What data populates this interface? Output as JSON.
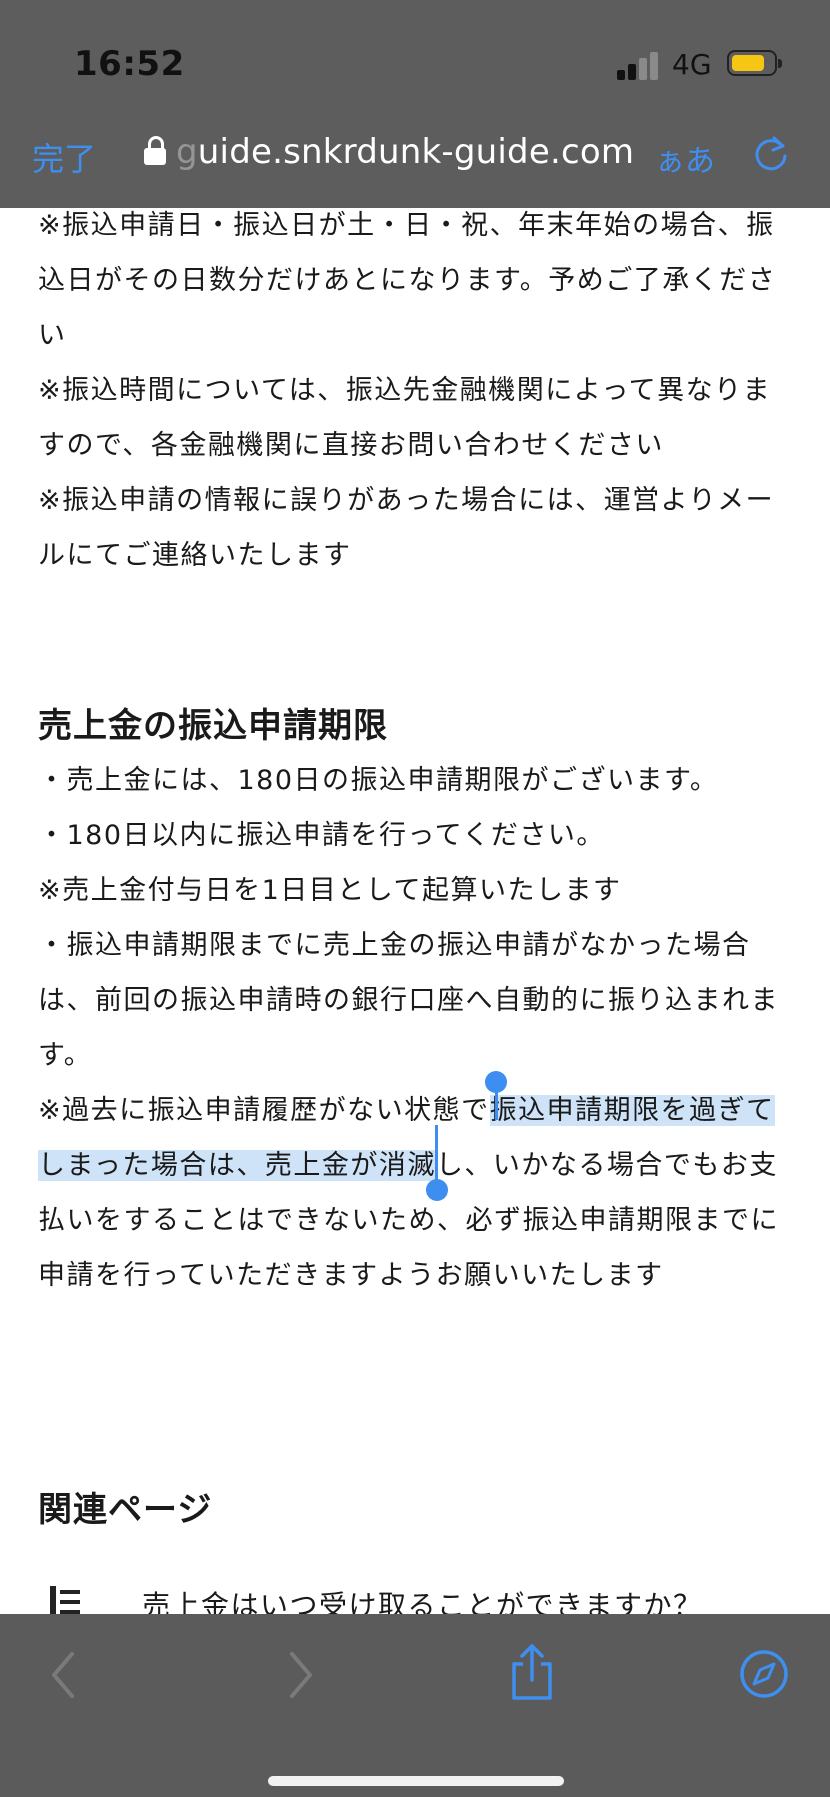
{
  "status": {
    "time": "16:52",
    "network": "4G",
    "battery_color": "#f5c614"
  },
  "browser": {
    "done_label": "完了",
    "url_faded": "g",
    "url": "uide.snkrdunk-guide.com",
    "reader_label": "ぁあ"
  },
  "content": {
    "notes": [
      "※振込申請日・振込日が土・日・祝、年末年始の場合、振込日がその日数分だけあとになります。予めご了承ください",
      "※振込時間については、振込先金融機関によって異なりますので、各金融機関に直接お問い合わせください",
      "※振込申請の情報に誤りがあった場合には、運営よりメールにてご連絡いたします"
    ],
    "section_title": "売上金の振込申請期限",
    "section_lines": [
      "・売上金には、180日の振込申請期限がございます。",
      "・180日以内に振込申請を行ってください。",
      "※売上金付与日を1日目として起算いたします",
      "・振込申請期限までに売上金の振込申請がなかった場合は、前回の振込申請時の銀行口座へ自動的に振り込まれます。"
    ],
    "warning_pre": "※過去に振込申請履歴がない状態で",
    "warning_selected": "振込申請期限を過ぎてしまった場合は、売上金が消滅",
    "warning_post": "し、いかなる場合でもお支払いをすることはできないため、必ず振込申請期限までに申請を行っていただきますようお願いいたします",
    "related_title": "関連ページ",
    "related_item": "売上金はいつ受け取ることができますか？"
  },
  "colors": {
    "accent": "#3f8ff0",
    "selection": "#cfe3f8",
    "chrome": "#5d5d5d"
  }
}
